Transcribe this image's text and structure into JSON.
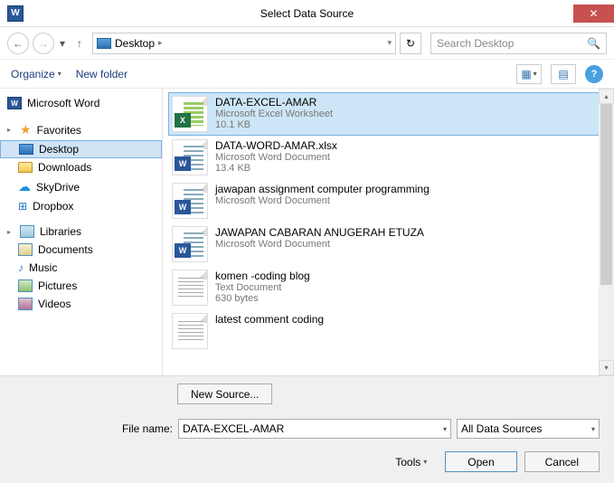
{
  "titlebar": {
    "title": "Select Data Source",
    "word_glyph": "W",
    "close_glyph": "✕"
  },
  "nav": {
    "back": "←",
    "forward": "→",
    "dd": "▾",
    "up": "↑",
    "breadcrumb_icon": "monitor",
    "breadcrumb_label": "Desktop",
    "breadcrumb_sep": "▸",
    "bc_dd": "▾",
    "refresh": "↻",
    "search_placeholder": "Search Desktop",
    "mag": "🔍"
  },
  "toolbar": {
    "organize": "Organize",
    "dd": "▾",
    "new_folder": "New folder",
    "view_glyph": "▦",
    "view2_glyph": "▤",
    "help_glyph": "?"
  },
  "sidebar": {
    "word": "Microsoft Word",
    "fav_header": "Favorites",
    "favs": [
      {
        "label": "Desktop"
      },
      {
        "label": "Downloads"
      },
      {
        "label": "SkyDrive"
      },
      {
        "label": "Dropbox"
      }
    ],
    "lib_header": "Libraries",
    "libs": [
      {
        "label": "Documents"
      },
      {
        "label": "Music"
      },
      {
        "label": "Pictures"
      },
      {
        "label": "Videos"
      }
    ]
  },
  "files": [
    {
      "name": "DATA-EXCEL-AMAR",
      "type": "Microsoft Excel Worksheet",
      "size": "10.1 KB",
      "icon": "excel",
      "selected": true
    },
    {
      "name": "DATA-WORD-AMAR.xlsx",
      "type": "Microsoft Word Document",
      "size": "13.4 KB",
      "icon": "word"
    },
    {
      "name": "jawapan assignment computer programming",
      "type": "Microsoft Word Document",
      "size": "",
      "icon": "word"
    },
    {
      "name": "JAWAPAN CABARAN ANUGERAH ETUZA",
      "type": "Microsoft Word Document",
      "size": "",
      "icon": "word"
    },
    {
      "name": "komen -coding blog",
      "type": "Text Document",
      "size": "630 bytes",
      "icon": "txt"
    },
    {
      "name": "latest comment coding",
      "type": "",
      "size": "",
      "icon": "txt"
    }
  ],
  "footer": {
    "new_source": "New Source...",
    "filename_label": "File name:",
    "filename_value": "DATA-EXCEL-AMAR",
    "filter": "All Data Sources",
    "tools": "Tools",
    "open": "Open",
    "cancel": "Cancel",
    "dd": "▾"
  },
  "scrollbar": {
    "up": "▴",
    "down": "▾"
  }
}
